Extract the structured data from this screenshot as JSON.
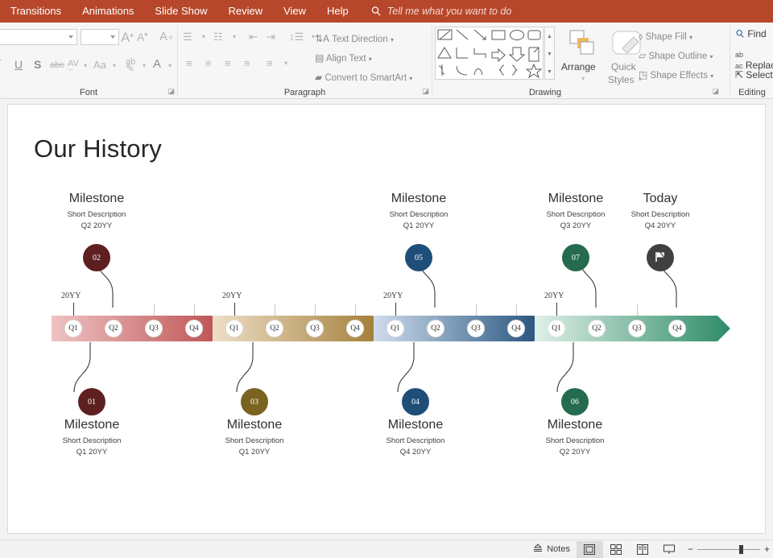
{
  "app": {
    "ribbon_tabs": [
      {
        "label": "Transitions",
        "name": "tab-transitions"
      },
      {
        "label": "Animations",
        "name": "tab-animations"
      },
      {
        "label": "Slide Show",
        "name": "tab-slide-show"
      },
      {
        "label": "Review",
        "name": "tab-review"
      },
      {
        "label": "View",
        "name": "tab-view"
      },
      {
        "label": "Help",
        "name": "tab-help"
      }
    ],
    "tell_me": "Tell me what you want to do",
    "accent_color": "#b7472a"
  },
  "ribbon": {
    "font_group": {
      "label": "Font",
      "font_name_value": "",
      "font_size_value": "",
      "grow_font": "A",
      "shrink_font": "A",
      "clear_formatting": "A",
      "italic": "I",
      "underline": "U",
      "shadow": "S",
      "strikethrough": "abc",
      "character_spacing": "AV",
      "change_case": "Aa",
      "text_highlight": "ab",
      "font_color": "A"
    },
    "paragraph_group": {
      "label": "Paragraph",
      "text_direction": "Text Direction",
      "align_text": "Align Text",
      "convert_to_smartart": "Convert to SmartArt"
    },
    "drawing_group": {
      "label": "Drawing",
      "arrange": "Arrange",
      "quick_styles_line1": "Quick",
      "quick_styles_line2": "Styles",
      "shape_fill": "Shape Fill",
      "shape_outline": "Shape Outline",
      "shape_effects": "Shape Effects"
    },
    "editing_group": {
      "label": "Editing",
      "find": "Find",
      "replace": "Replace",
      "select": "Select"
    }
  },
  "slide": {
    "title": "Our History",
    "timeline": {
      "segments": [
        {
          "name": "segment-1",
          "color_start": "#eec3c3",
          "color_end": "#bc4f4f",
          "quarters": [
            "Q1",
            "Q2",
            "Q3",
            "Q4"
          ],
          "year_label": "20YY"
        },
        {
          "name": "segment-2",
          "color_start": "#eadcc6",
          "color_end": "#a07a32",
          "quarters": [
            "Q1",
            "Q2",
            "Q3",
            "Q4"
          ],
          "year_label": "20YY"
        },
        {
          "name": "segment-3",
          "color_start": "#ccdced",
          "color_end": "#1f4e79",
          "quarters": [
            "Q1",
            "Q2",
            "Q3",
            "Q4"
          ],
          "year_label": "20YY"
        },
        {
          "name": "segment-4",
          "color_start": "#dceee4",
          "color_end": "#2e8b68",
          "quarters": [
            "Q1",
            "Q2",
            "Q3",
            "Q4"
          ],
          "year_label": "20YY"
        }
      ],
      "milestones_top": [
        {
          "name": "milestone-02",
          "number": "02",
          "title": "Milestone",
          "description": "Short Description",
          "date": "Q2 20YY",
          "color": "#5e1f20"
        },
        {
          "name": "milestone-05",
          "number": "05",
          "title": "Milestone",
          "description": "Short Description",
          "date": "Q1 20YY",
          "color": "#1f4e79"
        },
        {
          "name": "milestone-07",
          "number": "07",
          "title": "Milestone",
          "description": "Short Description",
          "date": "Q3 20YY",
          "color": "#256b4f"
        },
        {
          "name": "milestone-today",
          "number": "",
          "title": "Today",
          "description": "Short Description",
          "date": "Q4 20YY",
          "color": "#404040"
        }
      ],
      "milestones_bottom": [
        {
          "name": "milestone-01",
          "number": "01",
          "title": "Milestone",
          "description": "Short Description",
          "date": "Q1 20YY",
          "color": "#5e1f20"
        },
        {
          "name": "milestone-03",
          "number": "03",
          "title": "Milestone",
          "description": "Short Description",
          "date": "Q1 20YY",
          "color": "#7a6220"
        },
        {
          "name": "milestone-04",
          "number": "04",
          "title": "Milestone",
          "description": "Short Description",
          "date": "Q4 20YY",
          "color": "#1f4e79"
        },
        {
          "name": "milestone-06",
          "number": "06",
          "title": "Milestone",
          "description": "Short Description",
          "date": "Q2 20YY",
          "color": "#256b4f"
        }
      ]
    }
  },
  "status_bar": {
    "notes": "Notes",
    "views": [
      "normal-view",
      "slide-sorter-view",
      "reading-view",
      "slide-show-view"
    ],
    "active_view": "normal-view",
    "zoom_out": "−",
    "zoom_in": "+"
  }
}
